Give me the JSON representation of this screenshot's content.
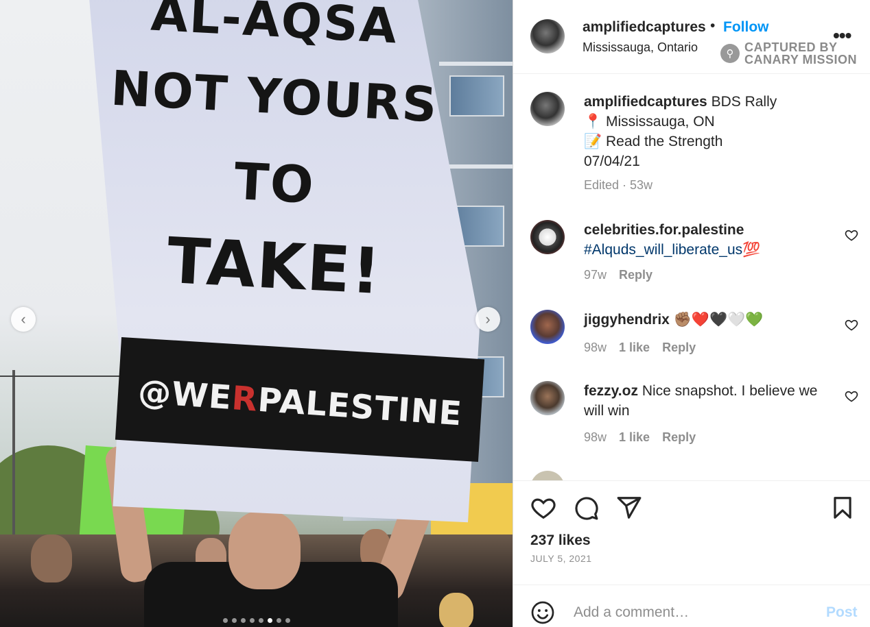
{
  "photo": {
    "placard_lines": [
      "AL-AQSA",
      "NOT YOURS",
      "TO",
      "TAKE!"
    ],
    "band_prefix": "@WE",
    "band_red": "R",
    "band_suffix": "PALESTINE",
    "carousel_total": 8,
    "carousel_active": 6
  },
  "header": {
    "username": "amplifiedcaptures",
    "separator": "•",
    "follow_label": "Follow",
    "location": "Mississauga, Ontario",
    "more_icon": "more-horizontal-icon",
    "watermark_line1": "CAPTURED BY",
    "watermark_line2": "CANARY MISSION"
  },
  "caption": {
    "username": "amplifiedcaptures",
    "text": "BDS Rally",
    "line2": "📍 Mississauga, ON",
    "line3": "📝 Read the Strength",
    "line4": "07/04/21",
    "meta": "Edited · 53w"
  },
  "comments": [
    {
      "username": "celebrities.for.palestine",
      "text": "#Alquds_will_liberate_us💯",
      "age": "97w",
      "likes": "",
      "reply": "Reply"
    },
    {
      "username": "jiggyhendrix",
      "text": "✊🏽❤️🖤🤍💚",
      "age": "98w",
      "likes": "1 like",
      "reply": "Reply"
    },
    {
      "username": "fezzy.oz",
      "text": "Nice snapshot. I believe we will win",
      "age": "98w",
      "likes": "1 like",
      "reply": "Reply"
    }
  ],
  "actions": {
    "likes": "237 likes",
    "date": "JULY 5, 2021"
  },
  "comment_box": {
    "placeholder": "Add a comment…",
    "post_label": "Post"
  },
  "colors": {
    "accent": "#0095f6",
    "post_disabled": "#b3dbff",
    "muted": "#8e8e8e",
    "hashtag": "#00376b"
  }
}
